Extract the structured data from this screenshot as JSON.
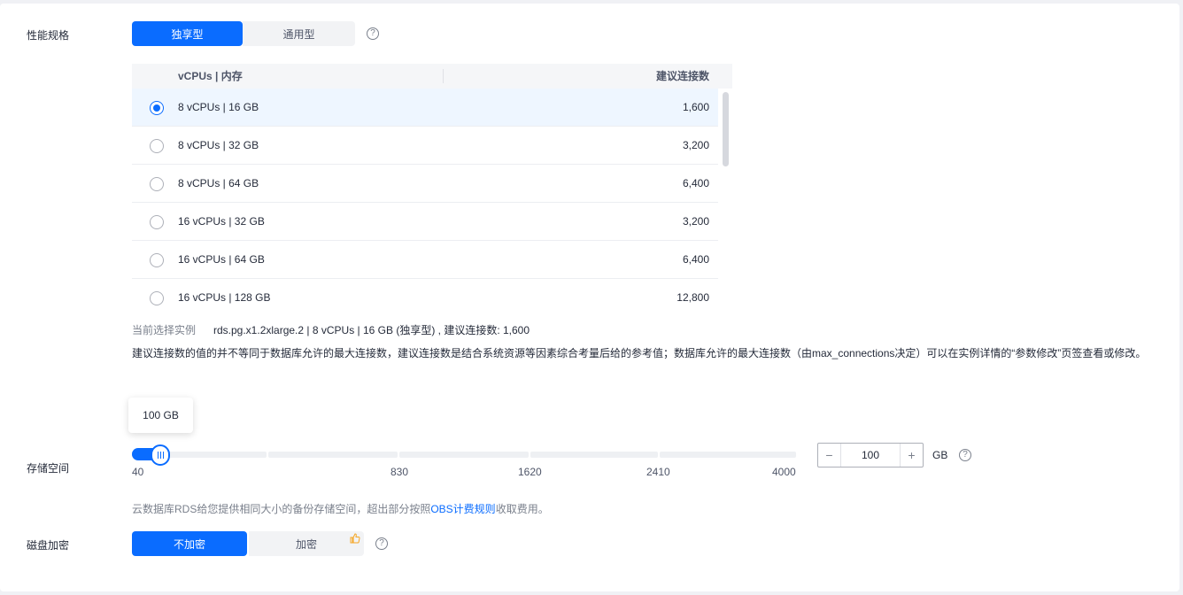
{
  "performance": {
    "label": "性能规格",
    "types": [
      "独享型",
      "通用型"
    ],
    "selected_type_index": 0,
    "help_icon": "question-circle-icon"
  },
  "spec_table": {
    "columns": [
      "vCPUs | 内存",
      "建议连接数"
    ],
    "rows": [
      {
        "spec": "8 vCPUs | 16 GB",
        "connections": "1,600",
        "selected": true
      },
      {
        "spec": "8 vCPUs | 32 GB",
        "connections": "3,200",
        "selected": false
      },
      {
        "spec": "8 vCPUs | 64 GB",
        "connections": "6,400",
        "selected": false
      },
      {
        "spec": "16 vCPUs | 32 GB",
        "connections": "3,200",
        "selected": false
      },
      {
        "spec": "16 vCPUs | 64 GB",
        "connections": "6,400",
        "selected": false
      },
      {
        "spec": "16 vCPUs | 128 GB",
        "connections": "12,800",
        "selected": false
      }
    ]
  },
  "current_selection": {
    "label": "当前选择实例",
    "value": "rds.pg.x1.2xlarge.2 | 8 vCPUs | 16 GB (独享型) , 建议连接数: 1,600"
  },
  "note": "建议连接数的值的并不等同于数据库允许的最大连接数，建议连接数是结合系统资源等因素综合考量后给的参考值；数据库允许的最大连接数（由max_connections决定）可以在实例详情的“参数修改”页签查看或修改。",
  "storage": {
    "label": "存储空间",
    "tooltip": "100 GB",
    "ticks": [
      "40",
      "830",
      "1620",
      "2410",
      "4000"
    ],
    "value": "100",
    "min": 40,
    "max": 4000,
    "unit": "GB",
    "help_icon": "question-circle-icon",
    "note_prefix": "云数据库RDS给您提供相同大小的备份存储空间，超出部分按照",
    "note_link": "OBS计费规则",
    "note_suffix": "收取费用。"
  },
  "encryption": {
    "label": "磁盘加密",
    "options": [
      "不加密",
      "加密"
    ],
    "selected_index": 0,
    "badge_icon": "thumbs-up-icon",
    "help_icon": "question-circle-icon"
  },
  "colors": {
    "accent": "#0a6cff",
    "badge": "#f5a623"
  }
}
